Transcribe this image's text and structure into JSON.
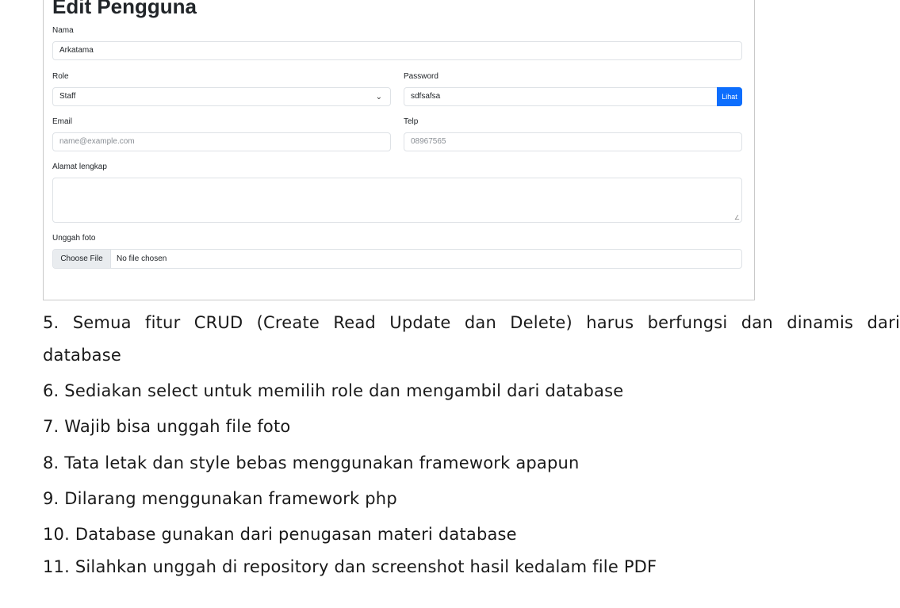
{
  "form": {
    "title": "Edit Pengguna",
    "nama": {
      "label": "Nama",
      "value": "Arkatama"
    },
    "role": {
      "label": "Role",
      "value": "Staff"
    },
    "password": {
      "label": "Password",
      "value": "sdfsafsa",
      "button": "Lihat"
    },
    "email": {
      "label": "Email",
      "placeholder": "name@example.com"
    },
    "telp": {
      "label": "Telp",
      "placeholder": "08967565"
    },
    "alamat": {
      "label": "Alamat lengkap",
      "value": ""
    },
    "foto": {
      "label": "Unggah foto",
      "button": "Choose File",
      "status": "No file chosen"
    }
  },
  "doc": {
    "lines": [
      "5. Semua fitur CRUD (Create Read Update dan Delete) harus berfungsi dan dinamis dari",
      "database",
      "6. Sediakan select untuk memilih role dan mengambil dari database",
      "7. Wajib bisa unggah file foto",
      "8. Tata letak dan style bebas menggunakan framework apapun",
      "9. Dilarang menggunakan framework php",
      "10. Database gunakan dari penugasan materi database",
      "11. Silahkan unggah di repository dan screenshot hasil kedalam file PDF"
    ]
  },
  "icons": {
    "select_chevron": "chevron-down-icon",
    "resize_grip": "resize-grip-icon"
  }
}
